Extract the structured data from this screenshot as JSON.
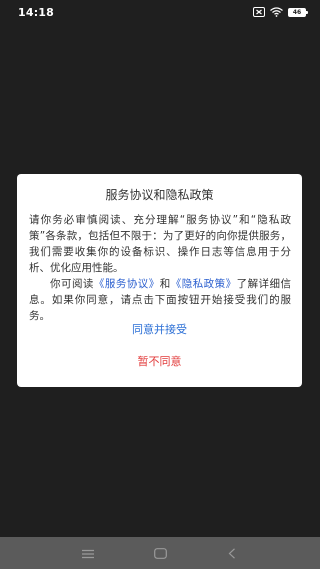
{
  "status_bar": {
    "time": "14:18",
    "icons": [
      "sim-x-icon",
      "wifi-icon",
      "battery-icon"
    ],
    "battery_level": "46"
  },
  "dialog": {
    "title": "服务协议和隐私政策",
    "para1": "请你务必审慎阅读、充分理解“服务协议”和“隐私政策”各条款，包括但不限于：为了更好的向你提供服务，我们需要收集你的设备标识、操作日志等信息用于分析、优化应用性能。",
    "para2_prefix": "你可阅读",
    "service_link": "《服务协议》",
    "para2_and": "和",
    "privacy_link": "《隐私政策》",
    "para2_suffix": "了解详细信息。如果你同意，请点击下面按钮开始接受我们的服务。",
    "accept_label": "同意并接受",
    "decline_label": "暂不同意"
  },
  "nav_bar": {
    "buttons": [
      "menu-icon",
      "home-icon",
      "back-icon"
    ]
  },
  "colors": {
    "background": "#1f1f1f",
    "dialog_bg": "#ffffff",
    "link": "#2b5fcf",
    "accept": "#2b6fd6",
    "decline": "#e23b3b",
    "nav_bar": "#5b5b5b"
  }
}
